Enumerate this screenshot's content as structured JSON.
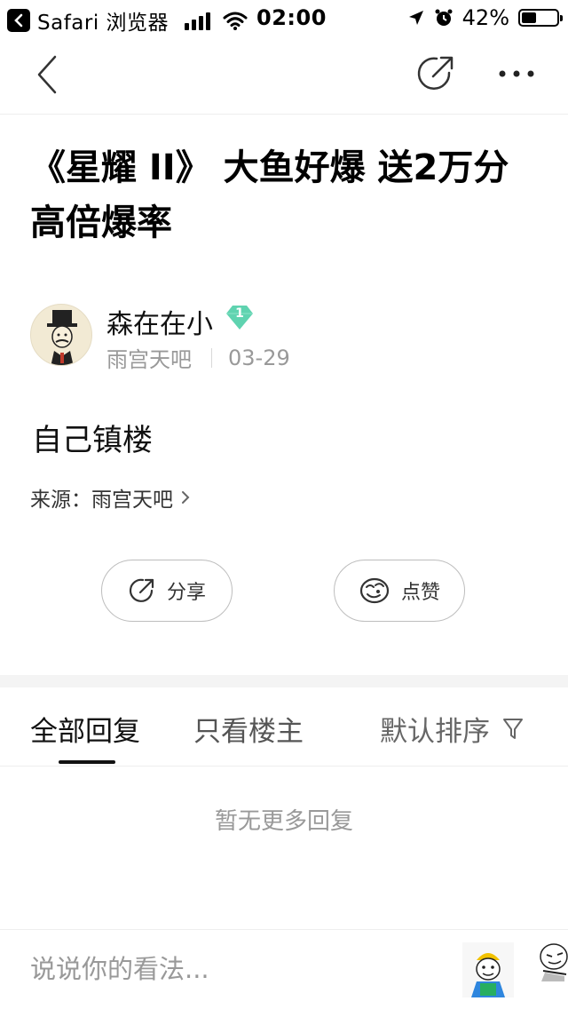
{
  "status_bar": {
    "app": "Safari 浏览器",
    "time": "02:00",
    "battery": "42%",
    "battery_level": 0.42
  },
  "post": {
    "title": "《星耀 II》 大鱼好爆 送2万分 高倍爆率",
    "author": {
      "name": "森在在小",
      "level": "1"
    },
    "forum": "雨宫天吧",
    "date": "03-29",
    "content": "自己镇楼",
    "source_label": "来源：",
    "source_value": "雨宫天吧"
  },
  "actions": {
    "share": "分享",
    "like": "点赞"
  },
  "tabs": {
    "all": "全部回复",
    "owner_only": "只看楼主",
    "sort": "默认排序"
  },
  "replies": {
    "empty_text": "暂无更多回复"
  },
  "comment_bar": {
    "placeholder": "说说你的看法..."
  },
  "colors": {
    "badge": "#5fd3b0",
    "text_primary": "#111111",
    "text_secondary": "#999999"
  }
}
